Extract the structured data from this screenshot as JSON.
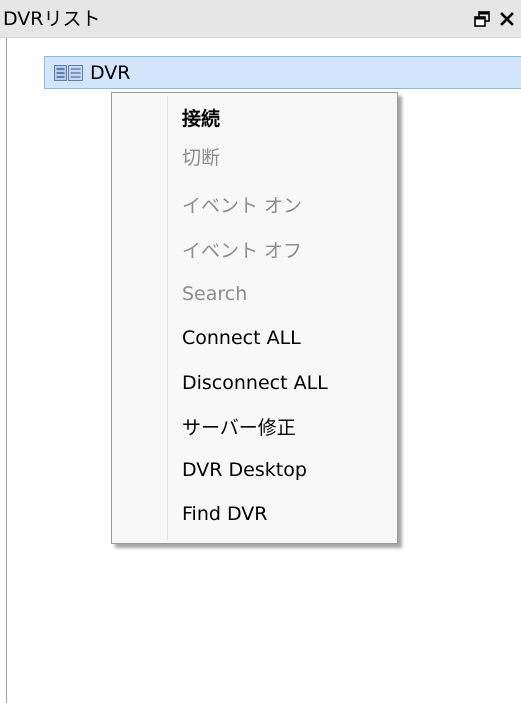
{
  "panel": {
    "title": "DVRリスト",
    "float_icon": "restore-window-icon",
    "close_icon": "close-icon"
  },
  "tree": {
    "items": [
      {
        "label": "DVR",
        "icon": "dvr-device-icon",
        "selected": true
      }
    ]
  },
  "context_menu": {
    "items": [
      {
        "label": "接続",
        "enabled": true,
        "default": true
      },
      {
        "label": "切断",
        "enabled": false
      },
      {
        "label": "イベント オン",
        "enabled": false
      },
      {
        "label": "イベント オフ",
        "enabled": false
      },
      {
        "label": "Search",
        "enabled": false
      },
      {
        "label": "Connect ALL",
        "enabled": true
      },
      {
        "label": "Disconnect ALL",
        "enabled": true
      },
      {
        "label": "サーバー修正",
        "enabled": true
      },
      {
        "label": "DVR Desktop",
        "enabled": true
      },
      {
        "label": "Find DVR",
        "enabled": true
      }
    ]
  },
  "colors": {
    "selection_bg": "#d2e6fb",
    "selection_border": "#8fb8e8",
    "disabled_text": "#8d8d8d",
    "titlebar_bg": "#e6e6e6"
  }
}
